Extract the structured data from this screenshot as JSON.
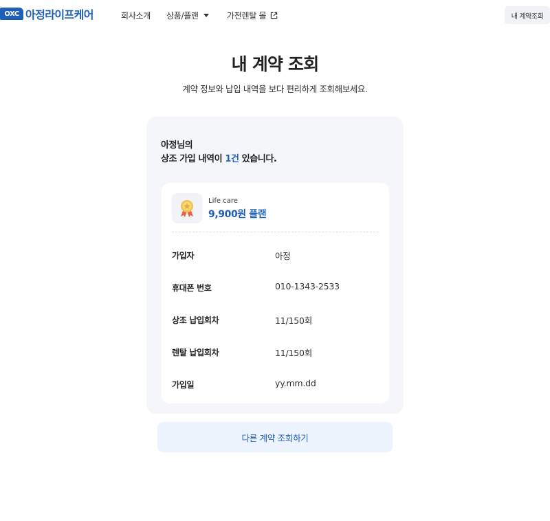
{
  "header": {
    "logo_mark": "OXC",
    "logo_text": "아정라이프케어",
    "nav": {
      "about": "회사소개",
      "products": "상품/플랜",
      "rental_mall": "가전렌탈 몰"
    },
    "my_contract_button": "내 계약조회"
  },
  "page": {
    "title": "내 계약 조회",
    "subtitle": "계약 정보와 납입 내역을 보다 편리하게 조회해보세요."
  },
  "summary": {
    "name_line": "아정님의",
    "line_prefix": "상조 가입 내역이",
    "count": "1건",
    "line_suffix": "있습니다."
  },
  "plan": {
    "badge_icon": "medal-icon",
    "category": "Life care",
    "name": "9,900원 플랜"
  },
  "details": {
    "subscriber": {
      "label": "가입자",
      "value": "아정"
    },
    "phone": {
      "label": "휴대폰 번호",
      "value": "010-1343-2533"
    },
    "funeral_payments": {
      "label": "상조 납입회차",
      "value": "11/150회"
    },
    "rental_payments": {
      "label": "렌탈 납입회차",
      "value": "11/150회"
    },
    "join_date": {
      "label": "가입일",
      "value": "yy.mm.dd"
    }
  },
  "actions": {
    "other_contract": "다른 계약 조회하기"
  },
  "colors": {
    "brand_blue": "#1f5fb8",
    "card_bg": "#f4f6fa",
    "button_bg": "#edf3fd"
  }
}
